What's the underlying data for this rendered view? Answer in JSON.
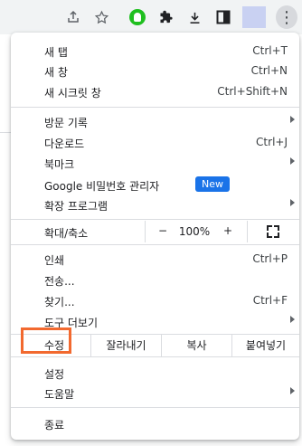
{
  "menu": {
    "new_tab": {
      "label": "새 탭",
      "shortcut": "Ctrl+T"
    },
    "new_window": {
      "label": "새 창",
      "shortcut": "Ctrl+N"
    },
    "new_incognito": {
      "label": "새 시크릿 창",
      "shortcut": "Ctrl+Shift+N"
    },
    "history": {
      "label": "방문 기록"
    },
    "downloads": {
      "label": "다운로드",
      "shortcut": "Ctrl+J"
    },
    "bookmarks": {
      "label": "북마크"
    },
    "password_manager": {
      "label": "Google 비밀번호 관리자",
      "badge": "New"
    },
    "extensions": {
      "label": "확장 프로그램"
    },
    "zoom": {
      "label": "확대/축소",
      "minus": "−",
      "value": "100%",
      "plus": "+"
    },
    "print": {
      "label": "인쇄",
      "shortcut": "Ctrl+P"
    },
    "cast": {
      "label": "전송..."
    },
    "find": {
      "label": "찾기...",
      "shortcut": "Ctrl+F"
    },
    "more_tools": {
      "label": "도구 더보기"
    },
    "edit": {
      "label": "수정",
      "cut": "잘라내기",
      "copy": "복사",
      "paste": "붙여넣기"
    },
    "settings": {
      "label": "설정"
    },
    "help": {
      "label": "도움말"
    },
    "exit": {
      "label": "종료"
    }
  },
  "colors": {
    "highlight": "#f2692f",
    "badge": "#1a73e8"
  }
}
